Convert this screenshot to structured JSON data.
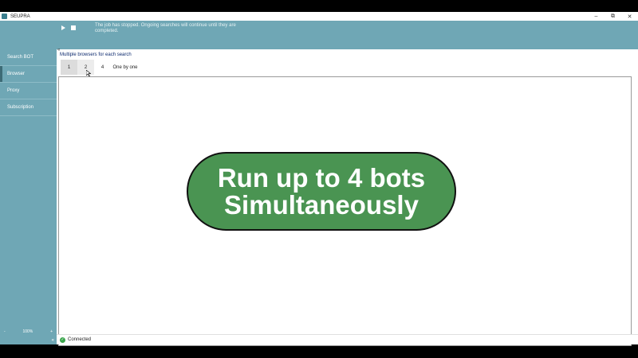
{
  "app": {
    "title": "SEUPRA"
  },
  "window_controls": {
    "minimize": "–",
    "maximize": "⧉",
    "close": "✕"
  },
  "toolbar": {
    "status_message": "The job has stopped. Ongoing searches will continue until they are completed."
  },
  "sidebar": {
    "items": [
      {
        "label": "Search BOT"
      },
      {
        "label": "Browser"
      },
      {
        "label": "Proxy"
      },
      {
        "label": "Subscription"
      }
    ],
    "zoom": {
      "minus": "-",
      "value": "100%",
      "plus": "+"
    },
    "collapse": "«"
  },
  "main": {
    "back": "«",
    "section_title": "Multiple browsers for each search",
    "options": [
      "1",
      "2",
      "4",
      "One by one"
    ],
    "selected_option": "1",
    "banner": {
      "line1": "Run up to 4 bots",
      "line2": "Simultaneously"
    }
  },
  "status": {
    "text": "Connected"
  },
  "colors": {
    "accent": "#6fa7b5",
    "banner_green": "#4a9452",
    "connected_green": "#3aa54b"
  }
}
